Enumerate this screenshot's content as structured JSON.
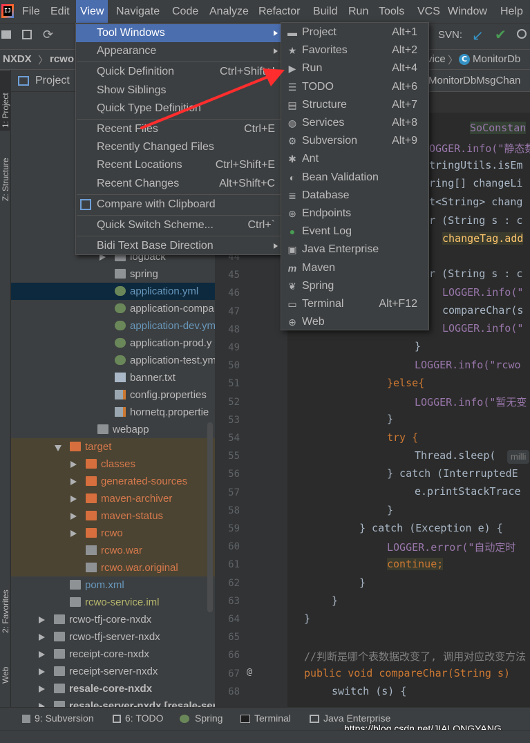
{
  "menubar": {
    "logo_text": "IJ",
    "items": [
      "File",
      "Edit",
      "View",
      "Navigate",
      "Code",
      "Analyze",
      "Refactor",
      "Build",
      "Run",
      "Tools",
      "VCS",
      "Window",
      "Help"
    ],
    "active": "View"
  },
  "toolbar": {
    "svn_label": "SVN:"
  },
  "breadcrumb": {
    "project": "NXDX",
    "module": "rcwo",
    "service": "vice",
    "class": "MonitorDb"
  },
  "project_panel": {
    "title": "Project"
  },
  "editor_tab": {
    "title": "MonitorDbMsgChan"
  },
  "left_stripe": {
    "project": "1: Project",
    "structure": "Z: Structure",
    "favorites": "2: Favorites",
    "web": "Web"
  },
  "tree": [
    {
      "label": "logback",
      "icon": "folder",
      "type": "normal"
    },
    {
      "label": "spring",
      "icon": "folder",
      "type": "normal"
    },
    {
      "label": "application.yml",
      "icon": "yml",
      "type": "selected"
    },
    {
      "label": "application-compa",
      "icon": "yml",
      "type": "normal"
    },
    {
      "label": "application-dev.ym",
      "icon": "yml",
      "type": "blue"
    },
    {
      "label": "application-prod.y",
      "icon": "yml",
      "type": "normal"
    },
    {
      "label": "application-test.ym",
      "icon": "yml",
      "type": "normal"
    },
    {
      "label": "banner.txt",
      "icon": "txt",
      "type": "normal"
    },
    {
      "label": "config.properties",
      "icon": "properties",
      "type": "normal"
    },
    {
      "label": "hornetq.propertie",
      "icon": "properties",
      "type": "normal"
    },
    {
      "label": "webapp",
      "icon": "folder",
      "type": "normal"
    },
    {
      "label": "target",
      "icon": "folder-orange",
      "type": "excluded"
    },
    {
      "label": "classes",
      "icon": "folder-orange",
      "type": "excluded"
    },
    {
      "label": "generated-sources",
      "icon": "folder-orange",
      "type": "excluded"
    },
    {
      "label": "maven-archiver",
      "icon": "folder-orange",
      "type": "excluded"
    },
    {
      "label": "maven-status",
      "icon": "folder-orange",
      "type": "excluded"
    },
    {
      "label": "rcwo",
      "icon": "folder-orange",
      "type": "excluded"
    },
    {
      "label": "rcwo.war",
      "icon": "war",
      "type": "excluded"
    },
    {
      "label": "rcwo.war.original",
      "icon": "war",
      "type": "excluded"
    },
    {
      "label": "pom.xml",
      "icon": "maven",
      "type": "normal"
    },
    {
      "label": "rcwo-service.iml",
      "icon": "iml",
      "type": "iml"
    },
    {
      "label": "rcwo-tfj-core-nxdx",
      "icon": "module",
      "type": "normal"
    },
    {
      "label": "rcwo-tfj-server-nxdx",
      "icon": "module",
      "type": "normal"
    },
    {
      "label": "receipt-core-nxdx",
      "icon": "module",
      "type": "normal"
    },
    {
      "label": "receipt-server-nxdx",
      "icon": "module",
      "type": "normal"
    },
    {
      "label": "resale-core-nxdx",
      "icon": "module",
      "type": "bold"
    },
    {
      "label": "resale-server-nxdx [resale-serv",
      "icon": "module",
      "type": "bold"
    }
  ],
  "line_numbers": [
    "44",
    "45",
    "46",
    "47",
    "48",
    "49",
    "50",
    "51",
    "52",
    "53",
    "54",
    "55",
    "56",
    "57",
    "58",
    "59",
    "60",
    "61",
    "62",
    "63",
    "64",
    "65",
    "66",
    "67",
    "68"
  ],
  "code": {
    "l_soconst": "SoConstan",
    "l_logger1": "OGGER.info(\"静态数",
    "l_stringutils": "tringUtils.isEm",
    "l_ring": "ring[] changeLi",
    "l_ltstring": "t<String> chang",
    "l_for1": "r (String s : c",
    "l_changetag": "changeTag.add",
    "l_for2": "r (String s : c",
    "l_info2": "LOGGER.info(\"",
    "l_compare": "compareChar(s",
    "l_info3": "LOGGER.info(\"",
    "l_brace1": "}",
    "l_rcwo": "LOGGER.info(\"rcwo",
    "l_else": "}else{",
    "l_nochange": "LOGGER.info(\"暂无变",
    "l_brace2": "}",
    "l_try": "try {",
    "l_sleep": "Thread.sleep(",
    "l_milli": "milli",
    "l_catch1": "} catch (InterruptedE",
    "l_trace": "e.printStackTrace",
    "l_brace3": "}",
    "l_catch2": "} catch (Exception e) {",
    "l_error": "LOGGER.error(\"自动定时",
    "l_continue": "continue;",
    "l_brace4": "}",
    "l_brace5": "}",
    "l_brace6": "}",
    "l_comment": "//判断是哪个表数据改变了, 调用对应改变方法",
    "l_method": "public void compareChar(String s)",
    "l_switch": "switch (s) {"
  },
  "view_menu": [
    {
      "label": "Tool Windows",
      "shortcut": "",
      "submenu": true,
      "active": true
    },
    {
      "label": "Appearance",
      "shortcut": "",
      "submenu": true
    },
    {
      "label": "Quick Definition",
      "shortcut": "Ctrl+Shift+I"
    },
    {
      "label": "Show Siblings",
      "shortcut": ""
    },
    {
      "label": "Quick Type Definition",
      "shortcut": ""
    },
    {
      "label": "Recent Files",
      "shortcut": "Ctrl+E"
    },
    {
      "label": "Recently Changed Files",
      "shortcut": ""
    },
    {
      "label": "Recent Locations",
      "shortcut": "Ctrl+Shift+E"
    },
    {
      "label": "Recent Changes",
      "shortcut": "Alt+Shift+C"
    },
    {
      "label": "Compare with Clipboard",
      "shortcut": ""
    },
    {
      "label": "Quick Switch Scheme...",
      "shortcut": "Ctrl+`"
    },
    {
      "label": "Bidi Text Base Direction",
      "shortcut": "",
      "submenu": true
    }
  ],
  "tool_windows": [
    {
      "label": "Project",
      "shortcut": "Alt+1",
      "icon": "folder-icon"
    },
    {
      "label": "Favorites",
      "shortcut": "Alt+2",
      "icon": "star-icon"
    },
    {
      "label": "Run",
      "shortcut": "Alt+4",
      "icon": "play-icon"
    },
    {
      "label": "TODO",
      "shortcut": "Alt+6",
      "icon": "list-icon"
    },
    {
      "label": "Structure",
      "shortcut": "Alt+7",
      "icon": "structure-icon"
    },
    {
      "label": "Services",
      "shortcut": "Alt+8",
      "icon": "services-icon"
    },
    {
      "label": "Subversion",
      "shortcut": "Alt+9",
      "icon": "subversion-icon"
    },
    {
      "label": "Ant",
      "shortcut": "",
      "icon": "ant-icon"
    },
    {
      "label": "Bean Validation",
      "shortcut": "",
      "icon": "bean-icon"
    },
    {
      "label": "Database",
      "shortcut": "",
      "icon": "database-icon"
    },
    {
      "label": "Endpoints",
      "shortcut": "",
      "icon": "endpoints-icon"
    },
    {
      "label": "Event Log",
      "shortcut": "",
      "icon": "event-log-icon"
    },
    {
      "label": "Java Enterprise",
      "shortcut": "",
      "icon": "java-enterprise-icon"
    },
    {
      "label": "Maven",
      "shortcut": "",
      "icon": "maven-icon"
    },
    {
      "label": "Spring",
      "shortcut": "",
      "icon": "spring-icon"
    },
    {
      "label": "Terminal",
      "shortcut": "Alt+F12",
      "icon": "terminal-icon"
    },
    {
      "label": "Web",
      "shortcut": "",
      "icon": "globe-icon"
    }
  ],
  "bottom_tabs": [
    {
      "label": "9: Subversion",
      "icon": "subversion-icon"
    },
    {
      "label": "6: TODO",
      "icon": "list-icon"
    },
    {
      "label": "Spring",
      "icon": "spring-icon"
    },
    {
      "label": "Terminal",
      "icon": "terminal-icon"
    },
    {
      "label": "Java Enterprise",
      "icon": "java-enterprise-icon"
    }
  ],
  "watermark": "https://blog.csdn.net/JIALONGYANG",
  "colors": {
    "accent": "#4b6eaf",
    "arrow": "#ff2d2d",
    "background": "#2b2b2b",
    "panel": "#3c3f41"
  }
}
